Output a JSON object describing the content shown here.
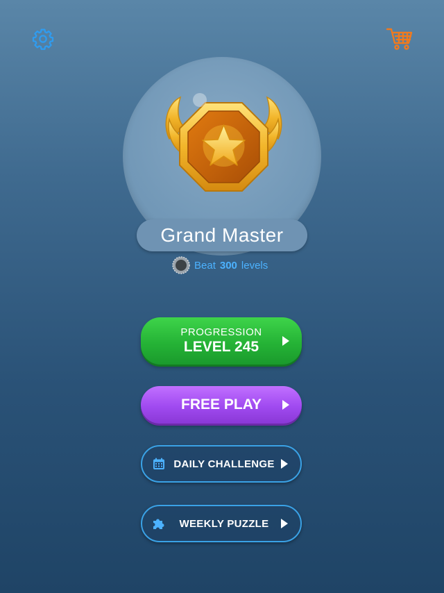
{
  "header": {
    "settings_icon": "gear-icon",
    "cart_icon": "shopping-cart-icon"
  },
  "colors": {
    "settings": "#2f9cf0",
    "cart": "#f07a1e",
    "progression": "#25b336",
    "free_play": "#a04af0",
    "outline": "#3aa2e6",
    "requirement": "#4cb2ff"
  },
  "rank": {
    "name": "Grand Master",
    "badge_icon": "winged-star-badge-icon",
    "requirement_prefix": "Beat",
    "requirement_count": "300",
    "requirement_suffix": "levels",
    "coin_icon": "gray-medal-icon"
  },
  "menu": {
    "progression": {
      "title": "PROGRESSION",
      "level": "LEVEL 245"
    },
    "free_play": {
      "label": "FREE PLAY"
    },
    "daily_challenge": {
      "label": "DAILY CHALLENGE",
      "icon": "calendar-icon"
    },
    "weekly_puzzle": {
      "label": "WEEKLY PUZZLE",
      "icon": "puzzle-piece-icon"
    }
  }
}
